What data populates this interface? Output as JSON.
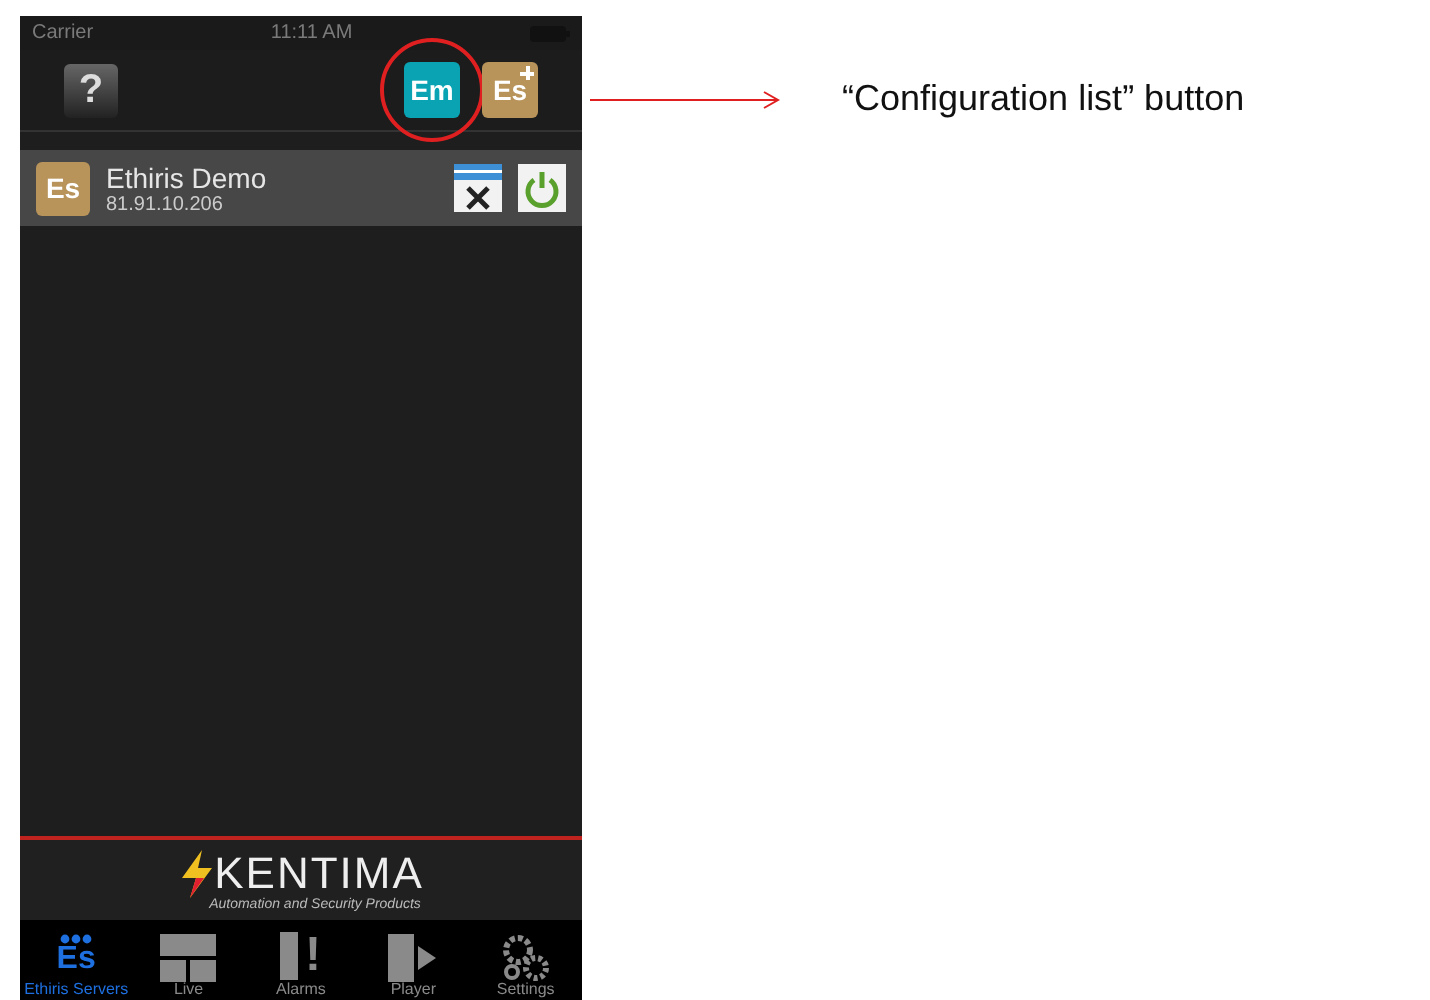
{
  "status_bar": {
    "carrier": "Carrier",
    "time": "11:11 AM"
  },
  "nav_bar": {
    "help_button": "?",
    "buttons": [
      {
        "label": "Em",
        "kind": "config",
        "circled": true
      },
      {
        "label": "Es",
        "kind": "add",
        "circled": false
      }
    ]
  },
  "servers": [
    {
      "badge": "Es",
      "name": "Ethiris Demo",
      "address": "81.91.10.206"
    }
  ],
  "logo": {
    "name": "KENTIMA",
    "tagline": "Automation and Security Products"
  },
  "tabs": [
    {
      "label": "Ethiris Servers",
      "kind": "servers",
      "glyph": "Es",
      "selected": true
    },
    {
      "label": "Live",
      "kind": "live",
      "selected": false
    },
    {
      "label": "Alarms",
      "kind": "alarms",
      "glyph": "!",
      "selected": false
    },
    {
      "label": "Player",
      "kind": "player",
      "selected": false
    },
    {
      "label": "Settings",
      "kind": "settings",
      "selected": false
    }
  ],
  "annotation": {
    "label": "“Configuration list” button"
  }
}
